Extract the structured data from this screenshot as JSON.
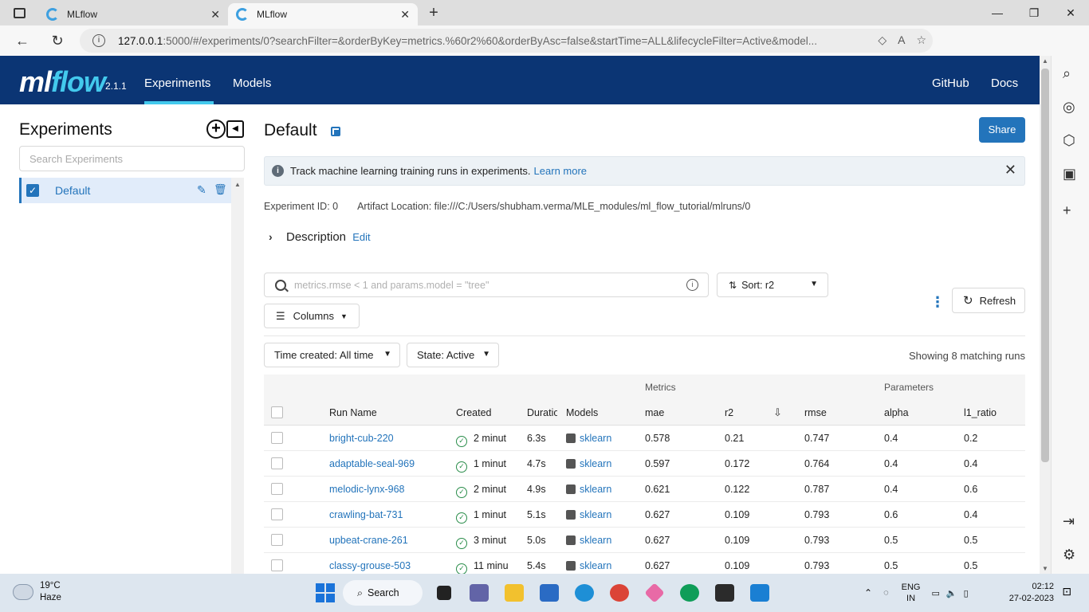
{
  "browser": {
    "tabs": [
      {
        "title": "MLflow"
      },
      {
        "title": "MLflow"
      }
    ],
    "url_host": "127.0.0.1",
    "url_rest": ":5000/#/experiments/0?searchFilter=&orderByKey=metrics.%60r2%60&orderByAsc=false&startTime=ALL&lifecycleFilter=Active&model..."
  },
  "header": {
    "logo_ml": "ml",
    "logo_flow": "flow",
    "version": "2.1.1",
    "nav": [
      "Experiments",
      "Models"
    ],
    "right_links": [
      "GitHub",
      "Docs"
    ]
  },
  "sidebar": {
    "title": "Experiments",
    "search_placeholder": "Search Experiments",
    "items": [
      {
        "label": "Default"
      }
    ]
  },
  "main": {
    "title": "Default",
    "share_label": "Share",
    "banner_text": "Track machine learning training runs in experiments.",
    "banner_link": "Learn more",
    "experiment_id": "Experiment ID: 0",
    "artifact_location": "Artifact Location: file:///C:/Users/shubham.verma/MLE_modules/ml_flow_tutorial/mlruns/0",
    "description_label": "Description",
    "description_edit": "Edit",
    "search_placeholder": "metrics.rmse < 1 and params.model = \"tree\"",
    "sort_label": "Sort: r2",
    "columns_label": "Columns",
    "refresh_label": "Refresh",
    "time_filter": "Time created: All time",
    "state_filter": "State: Active",
    "showing_text": "Showing 8 matching runs"
  },
  "table": {
    "group_headers": {
      "metrics": "Metrics",
      "parameters": "Parameters"
    },
    "columns": [
      "Run Name",
      "Created",
      "Duratio",
      "Models",
      "mae",
      "r2",
      "rmse",
      "alpha",
      "l1_ratio"
    ],
    "rows": [
      {
        "name": "bright-cub-220",
        "created": "2 minut",
        "duration": "6.3s",
        "model": "sklearn",
        "mae": "0.578",
        "r2": "0.21",
        "rmse": "0.747",
        "alpha": "0.4",
        "l1_ratio": "0.2"
      },
      {
        "name": "adaptable-seal-969",
        "created": "1 minut",
        "duration": "4.7s",
        "model": "sklearn",
        "mae": "0.597",
        "r2": "0.172",
        "rmse": "0.764",
        "alpha": "0.4",
        "l1_ratio": "0.4"
      },
      {
        "name": "melodic-lynx-968",
        "created": "2 minut",
        "duration": "4.9s",
        "model": "sklearn",
        "mae": "0.621",
        "r2": "0.122",
        "rmse": "0.787",
        "alpha": "0.4",
        "l1_ratio": "0.6"
      },
      {
        "name": "crawling-bat-731",
        "created": "1 minut",
        "duration": "5.1s",
        "model": "sklearn",
        "mae": "0.627",
        "r2": "0.109",
        "rmse": "0.793",
        "alpha": "0.6",
        "l1_ratio": "0.4"
      },
      {
        "name": "upbeat-crane-261",
        "created": "3 minut",
        "duration": "5.0s",
        "model": "sklearn",
        "mae": "0.627",
        "r2": "0.109",
        "rmse": "0.793",
        "alpha": "0.5",
        "l1_ratio": "0.5"
      },
      {
        "name": "classy-grouse-503",
        "created": "11 minu",
        "duration": "5.4s",
        "model": "sklearn",
        "mae": "0.627",
        "r2": "0.109",
        "rmse": "0.793",
        "alpha": "0.5",
        "l1_ratio": "0.5"
      }
    ]
  },
  "taskbar": {
    "temperature": "19°C",
    "weather": "Haze",
    "search_label": "Search",
    "lang_top": "ENG",
    "lang_bottom": "IN",
    "time": "02:12",
    "date": "27-02-2023"
  },
  "colors": {
    "header_bg": "#0b3574",
    "accent": "#2374bb",
    "logo_flow": "#43c9ed"
  }
}
